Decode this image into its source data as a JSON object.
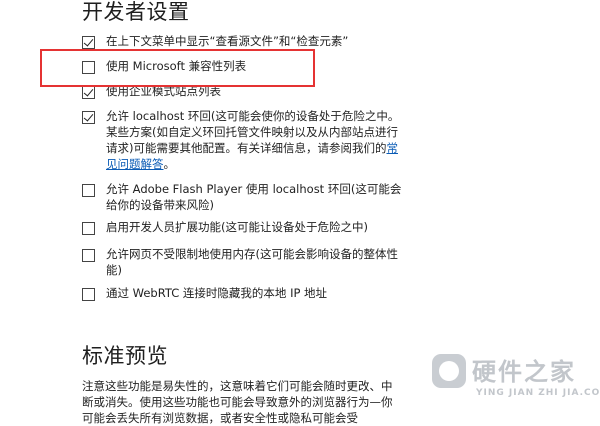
{
  "developer_section": {
    "title": "开发者设置"
  },
  "options": [
    {
      "id": "view-source",
      "label": "在上下文菜单中显示“查看源文件”和“检查元素”",
      "checked": true
    },
    {
      "id": "ms-compat-list",
      "label": "使用 Microsoft 兼容性列表",
      "checked": false,
      "highlighted": true
    },
    {
      "id": "enterprise-mode",
      "label": "使用企业模式站点列表",
      "checked": true
    },
    {
      "id": "localhost-loopback",
      "label_before_link": "允许 localhost 环回(这可能会使你的设备处于危险之中。某些方案(如自定义环回托管文件映射以及从内部站点进行请求)可能需要其他配置。有关详细信息，请参阅我们的",
      "link_text": "常见问题解答",
      "label_after_link": "。",
      "checked": true
    },
    {
      "id": "flash-localhost",
      "label": "允许 Adobe Flash Player 使用 localhost 环回(这可能会给你的设备带来风险)",
      "checked": false
    },
    {
      "id": "dev-extensions",
      "label": "启用开发人员扩展功能(这可能让设备处于危险之中)",
      "checked": false
    },
    {
      "id": "unlimited-memory",
      "label": "允许网页不受限制地使用内存(这可能会影响设备的整体性能)",
      "checked": false
    },
    {
      "id": "webrtc-ip",
      "label": "通过 WebRTC 连接时隐藏我的本地 IP 地址",
      "checked": false
    }
  ],
  "preview_section": {
    "title": "标准预览",
    "note": "注意这些功能是易失性的，这意味着它们可能会随时更改、中断或消失。使用这些功能也可能会导致意外的浏览器行为—你可能会丢失所有浏览数据，或者安全性或隐私可能会受"
  },
  "watermark": {
    "title": "硬件之家",
    "subtitle": "YING JIAN ZHI JIA.COM",
    "color": "#c2c6cb"
  },
  "colors": {
    "highlight": "#e53333",
    "link": "#0a5bb5"
  }
}
